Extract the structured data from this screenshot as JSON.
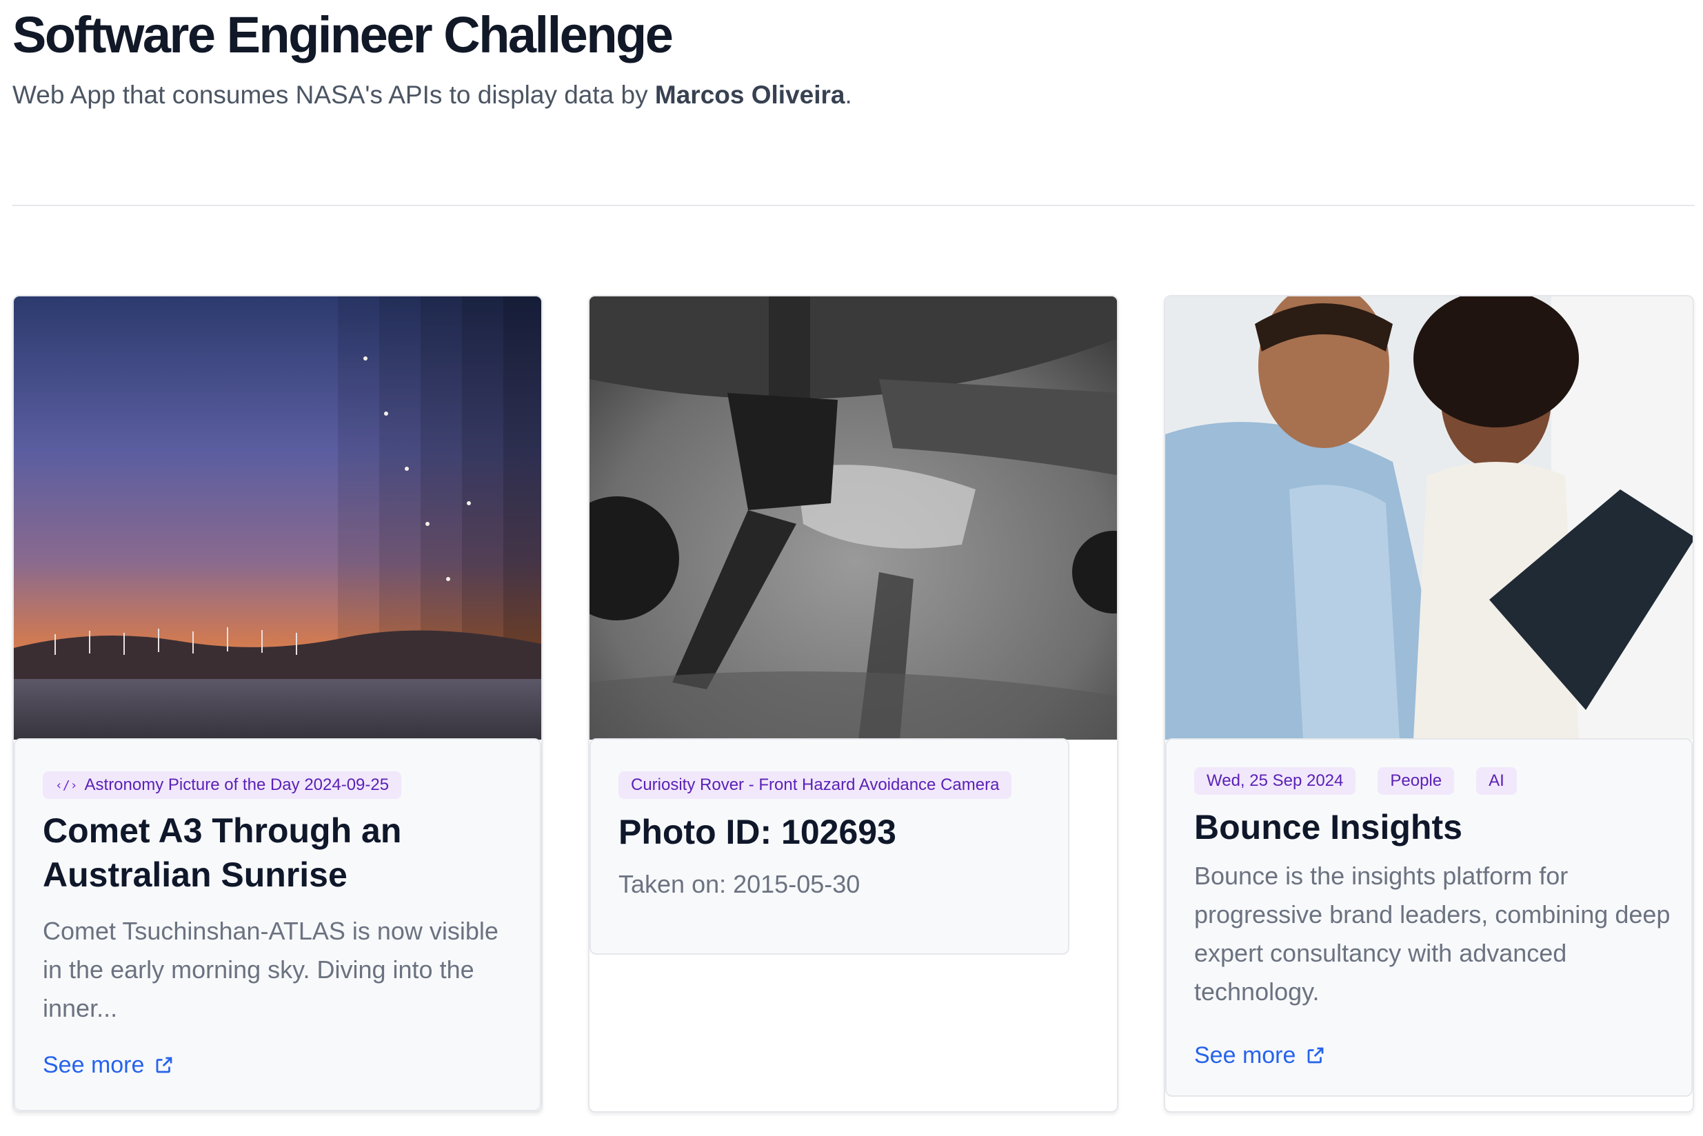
{
  "header": {
    "title": "Software Engineer Challenge",
    "subtitle_prefix": "Web App that consumes NASA's APIs to display data by ",
    "author": "Marcos Oliveira",
    "subtitle_suffix": "."
  },
  "cards": [
    {
      "image_alt": "Comet over wind turbines at sunrise",
      "badges": [
        "Astronomy Picture of the Day 2024-09-25"
      ],
      "title": "Comet A3 Through an Australian Sunrise",
      "text": "Comet Tsuchinshan-ATLAS is now visible in the early morning sky. Diving into the inner...",
      "link_label": "See more",
      "icon": "external-link-icon"
    },
    {
      "image_alt": "Curiosity rover hazcam view of Martian terrain",
      "badges": [
        "Curiosity Rover - Front Hazard Avoidance Camera"
      ],
      "title": "Photo ID: 102693",
      "text": "Taken on: 2015-05-30"
    },
    {
      "image_alt": "Two people looking at a tablet",
      "badges": [
        "Wed, 25 Sep 2024",
        "People",
        "AI"
      ],
      "title": "Bounce Insights",
      "text": "Bounce is the insights platform for progressive brand leaders, combining deep expert consultancy with advanced technology.",
      "link_label": "See more",
      "icon": "external-link-icon"
    }
  ],
  "colors": {
    "accent": "#2563eb",
    "badge_bg": "#f1e8fb",
    "badge_text": "#5b21b6"
  }
}
